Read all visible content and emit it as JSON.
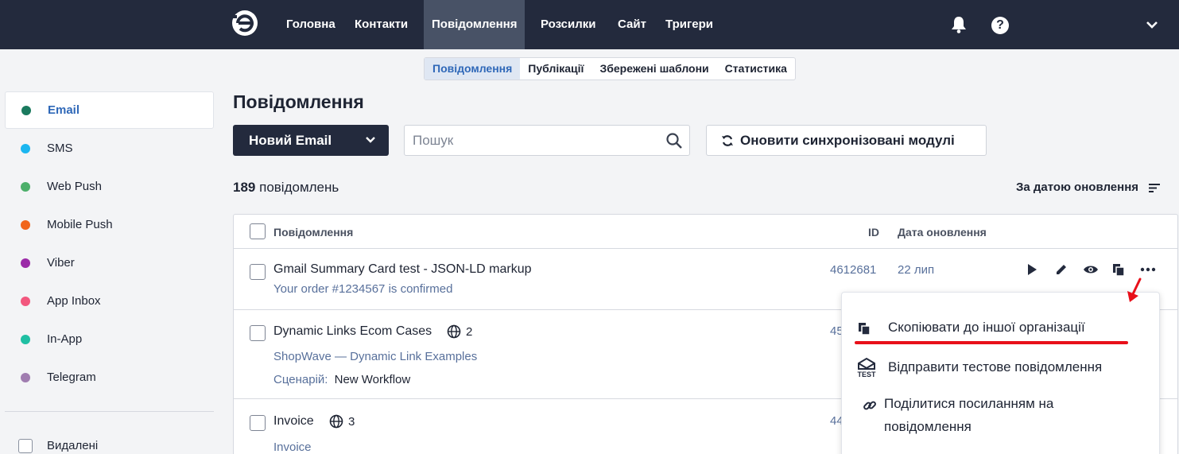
{
  "topnav": {
    "items": [
      {
        "label": "Головна"
      },
      {
        "label": "Контакти"
      },
      {
        "label": "Повідомлення"
      },
      {
        "label": "Розсилки"
      },
      {
        "label": "Сайт"
      },
      {
        "label": "Тригери"
      }
    ],
    "help_glyph": "?"
  },
  "subtabs": [
    {
      "label": "Повідомлення"
    },
    {
      "label": "Публікації"
    },
    {
      "label": "Збережені шаблони"
    },
    {
      "label": "Статистика"
    }
  ],
  "sidebar": {
    "channels": [
      {
        "label": "Email",
        "color": "#1a7a5e"
      },
      {
        "label": "SMS",
        "color": "#1bb6f0"
      },
      {
        "label": "Web Push",
        "color": "#4caf6a"
      },
      {
        "label": "Mobile Push",
        "color": "#f1651c"
      },
      {
        "label": "Viber",
        "color": "#9b2aa8"
      },
      {
        "label": "App Inbox",
        "color": "#f2577e"
      },
      {
        "label": "In-App",
        "color": "#1fbfa3"
      },
      {
        "label": "Telegram",
        "color": "#a07db0"
      }
    ],
    "deleted_label": "Видалені"
  },
  "main": {
    "title": "Повідомлення",
    "new_button_label": "Новий Email",
    "search_placeholder": "Пошук",
    "sync_button_label": "Оновити синхронізовані модулі",
    "count_number": "189",
    "count_label": "повідомлень",
    "sort_label": "За датою оновлення"
  },
  "table": {
    "headers": {
      "message": "Повідомлення",
      "id": "ID",
      "date": "Дата оновлення"
    },
    "rows": [
      {
        "title": "Gmail Summary Card test - JSON-LD markup",
        "subtitle": "Your order #1234567 is confirmed",
        "id": "4612681",
        "date": "22 лип"
      },
      {
        "title": "Dynamic Links Ecom Cases",
        "languages": "2",
        "subtitle": "ShopWave — Dynamic Link Examples",
        "scenario_label": "Сценарій:",
        "scenario_value": "New Workflow",
        "id": "45"
      },
      {
        "title": "Invoice",
        "languages": "3",
        "subtitle": "Invoice",
        "id": "44"
      }
    ]
  },
  "menu": {
    "copy_label": "Скопіювати до іншої організації",
    "test_label": "Відправити тестове повідомлення",
    "test_icon_text": "TEST",
    "share_label_line1": "Поділитися посиланням на",
    "share_label_line2": "повідомлення"
  },
  "colors": {
    "topbar": "#232a3d",
    "accent": "#2f68b8",
    "annotation": "#e8101a"
  }
}
